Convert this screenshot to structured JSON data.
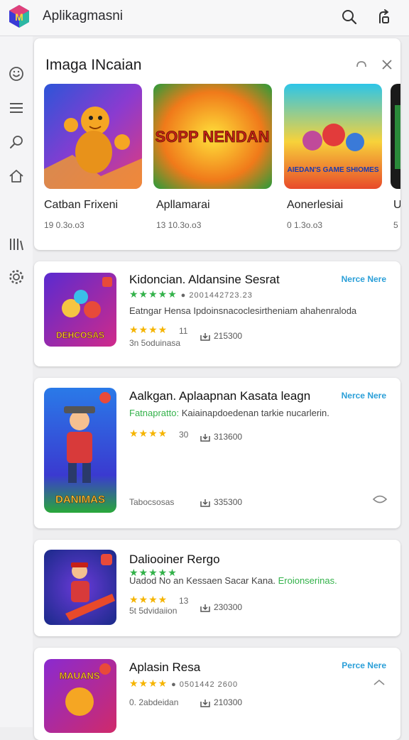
{
  "header": {
    "title": "Aplikagmasni",
    "icons": [
      "app-logo-icon",
      "search-icon",
      "settings-icon"
    ]
  },
  "sidebar": {
    "icons": [
      "emoji-icon",
      "menu-icon",
      "discover-icon",
      "home-icon",
      "library-icon",
      "gear-icon"
    ]
  },
  "featured": {
    "title": "Imaga INcaian",
    "items": [
      {
        "name": "Catban Frixeni",
        "meta": "19  0.3o.o3",
        "art_text": ""
      },
      {
        "name": "Apllamarai",
        "meta": "13  10.3o.o3",
        "art_text": "SOPP NENDAN"
      },
      {
        "name": "Aonerlesiai",
        "meta": "0  1.3o.o3",
        "art_text": "AIEDAN'S GAME SHIOMES"
      },
      {
        "name": "Ur",
        "meta": "5",
        "art_text": ""
      }
    ]
  },
  "apps": [
    {
      "name": "Kidoncian. Aldansine Sesrat",
      "more": "Nerce Nere",
      "stars_line": "●  2001442723.23",
      "desc": "Eatngar Hensa Ipdoinsnacoclesirtheniam ahahenraloda",
      "rating": "11",
      "downloads": "215300",
      "sub": "3n 5oduinasa",
      "art_text": "DEHCOSAS"
    },
    {
      "name": "Aalkgan. Aplaapnan Kasata leagn",
      "more": "Nerce Nere",
      "desc_label": "Fatnapratto:",
      "desc": "Kaiainapdoedenan tarkie nucarlerin.",
      "rating": "30",
      "downloads": "313600",
      "sub": "Tabocsosas",
      "downloads2": "335300",
      "art_text": "DANIMAS"
    },
    {
      "name": "Daliooiner Rergo",
      "desc": "Uadod No an Kessaen Sacar Kana.",
      "desc_green": "Eroionserinas.",
      "rating": "13",
      "downloads": "230300",
      "sub": "5t 5dvidaiion"
    },
    {
      "name": "Aplasin Resa",
      "more": "Perce Nere",
      "stars_line": "●  0501442 2600",
      "sub": "0. 2abdeidan",
      "downloads": "210300",
      "art_text": "MAUANS"
    }
  ],
  "colors": {
    "accent": "#2a9fd8",
    "star_green": "#33b24a",
    "star_gold": "#f5b400"
  }
}
